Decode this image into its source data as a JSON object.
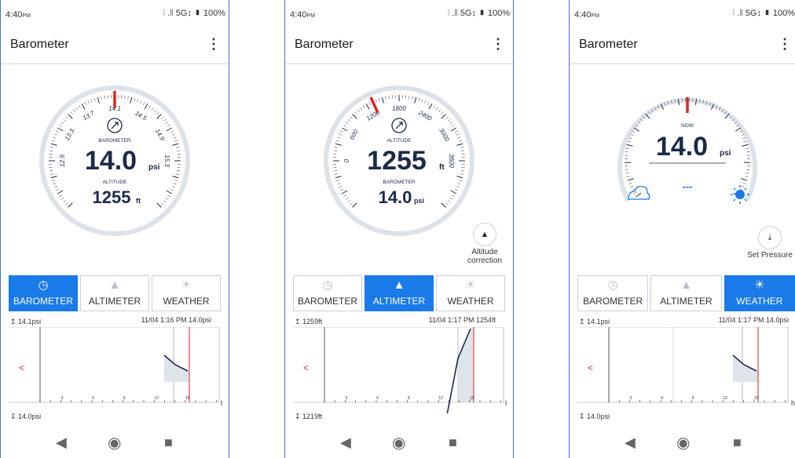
{
  "status": {
    "time": "4:40",
    "ampm": "PM",
    "indicators": "⫶ .∣∣ 5G↕ ▮ 100%"
  },
  "appbar": {
    "title": "Barometer",
    "menu_icon": "more-vert-icon"
  },
  "tabs": {
    "barometer": "BAROMETER",
    "altimeter": "ALTIMETER",
    "weather": "WEATHER"
  },
  "screens": [
    {
      "gauge": {
        "scale_labels": [
          "12.9",
          "13.3",
          "13.7",
          "14.1",
          "14.5",
          "14.9",
          "15.3"
        ],
        "needle_value": 14.0,
        "primary_label": "BAROMETER",
        "primary_value": "14.0",
        "primary_unit": "psi",
        "secondary_label": "ALTITUDE",
        "secondary_value": "1255",
        "secondary_unit": "ft"
      },
      "active_tab": "barometer",
      "graph": {
        "top": "14.1psi",
        "cursor": "11/04 1:16 PM  14.0psi",
        "bottom": "14.0psi",
        "hour_unit": "h",
        "ticks": [
          "3",
          "6",
          "9",
          "12",
          "15"
        ]
      }
    },
    {
      "gauge": {
        "scale_labels": [
          "0",
          "600",
          "1200",
          "1800",
          "2400",
          "3000",
          "3600"
        ],
        "needle_value": 1255,
        "primary_label": "ALTITUDE",
        "primary_value": "1255",
        "primary_unit": "ft",
        "secondary_label": "BAROMETER",
        "secondary_value": "14.0",
        "secondary_unit": "psi"
      },
      "side_button": {
        "label": "Altitude\ncorrection",
        "icon": "mountain-icon"
      },
      "active_tab": "altimeter",
      "graph": {
        "top": "1259ft",
        "cursor": "11/04 1:17 PM  1254ft",
        "bottom": "1219ft",
        "hour_unit": "h",
        "ticks": [
          "3",
          "6",
          "9",
          "12",
          "15"
        ]
      }
    },
    {
      "gauge": {
        "label": "NOW",
        "value": "14.0",
        "unit": "psi",
        "trend": "---",
        "left_icon": "cloud-icon",
        "right_icon": "sun-icon"
      },
      "side_button": {
        "label": "Set Pressure",
        "icon": "download-icon"
      },
      "active_tab": "weather",
      "graph": {
        "top": "14.1psi",
        "cursor": "11/04 1:17 PM  14.0psi",
        "bottom": "14.0psi",
        "hour_unit": "h",
        "ticks": [
          "3",
          "6",
          "9",
          "12",
          "15"
        ]
      }
    }
  ],
  "navbar": {
    "back": "◀",
    "home": "◉",
    "recents": "■"
  },
  "colors": {
    "accent": "#1a7ae8",
    "needle": "#e0221d",
    "ink": "#1c2a4a",
    "cursor_line": "#e0221d"
  }
}
